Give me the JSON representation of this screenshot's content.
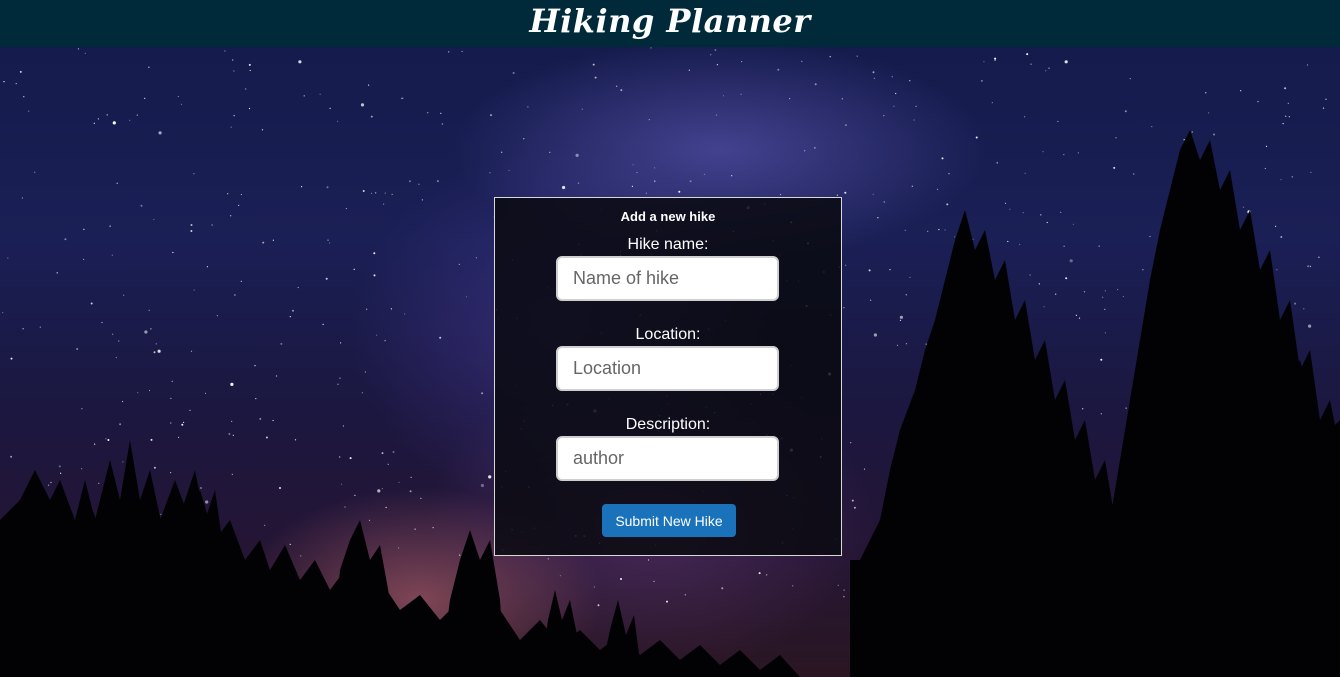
{
  "app": {
    "title": "Hiking Planner"
  },
  "form": {
    "heading": "Add a new hike",
    "fields": [
      {
        "label": "Hike name:",
        "placeholder": "Name of hike",
        "value": ""
      },
      {
        "label": "Location:",
        "placeholder": "Location",
        "value": ""
      },
      {
        "label": "Description:",
        "placeholder": "author",
        "value": ""
      }
    ],
    "submit_label": "Submit New Hike"
  },
  "colors": {
    "header_bg": "#002a3a",
    "button_bg": "#1a72bb",
    "panel_border": "#d8d8d8"
  }
}
